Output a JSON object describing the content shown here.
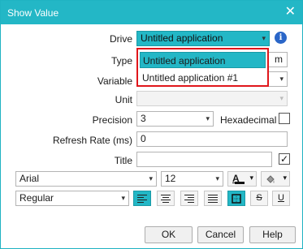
{
  "window": {
    "title": "Show Value",
    "close_glyph": "✕"
  },
  "form": {
    "drive": {
      "label": "Drive",
      "value": "Untitled application"
    },
    "type": {
      "label": "Type",
      "partial_value": "m"
    },
    "variable": {
      "label": "Variable"
    },
    "unit": {
      "label": "Unit",
      "value": ""
    },
    "precision": {
      "label": "Precision",
      "value": "3"
    },
    "hexadecimal": {
      "label": "Hexadecimal",
      "checked": false
    },
    "refresh_rate": {
      "label": "Refresh Rate (ms)",
      "value": "0"
    },
    "title": {
      "label": "Title",
      "value": "",
      "checked": true
    }
  },
  "dropdown": {
    "options": [
      "Untitled application",
      "Untitled application #1"
    ],
    "selected": "Untitled application"
  },
  "formatting": {
    "font_family": "Arial",
    "font_size": "12",
    "font_style": "Regular",
    "text_color_glyph": "A",
    "strikethrough_glyph": "S",
    "underline_glyph": "U"
  },
  "buttons": {
    "ok": "OK",
    "cancel": "Cancel",
    "help": "Help"
  },
  "icons": {
    "info": "info-icon",
    "dropdown_arrow": "▾",
    "check_glyph": "✓"
  },
  "colors": {
    "accent": "#23b7c6",
    "dropdown_highlight_border": "#e0161b",
    "info_blue": "#2a66c8"
  }
}
